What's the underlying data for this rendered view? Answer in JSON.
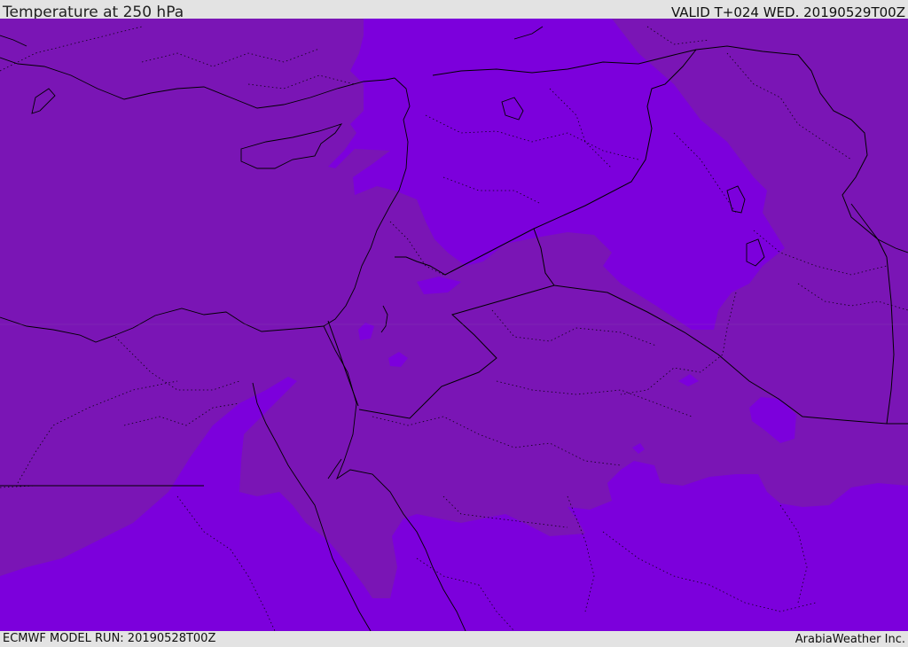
{
  "header": {
    "title": "Temperature at 250 hPa",
    "valid": "VALID T+024 WED. 20190529T00Z"
  },
  "footer": {
    "model_run": "ECMWF MODEL RUN: 20190528T00Z",
    "credit": "ArabiaWeather Inc."
  },
  "map": {
    "field": "temperature",
    "level": "250 hPa",
    "colors": {
      "warmer_band": "#7a15b5",
      "colder_band": "#7c00dc",
      "coastline": "#000000",
      "border": "#000000"
    }
  }
}
